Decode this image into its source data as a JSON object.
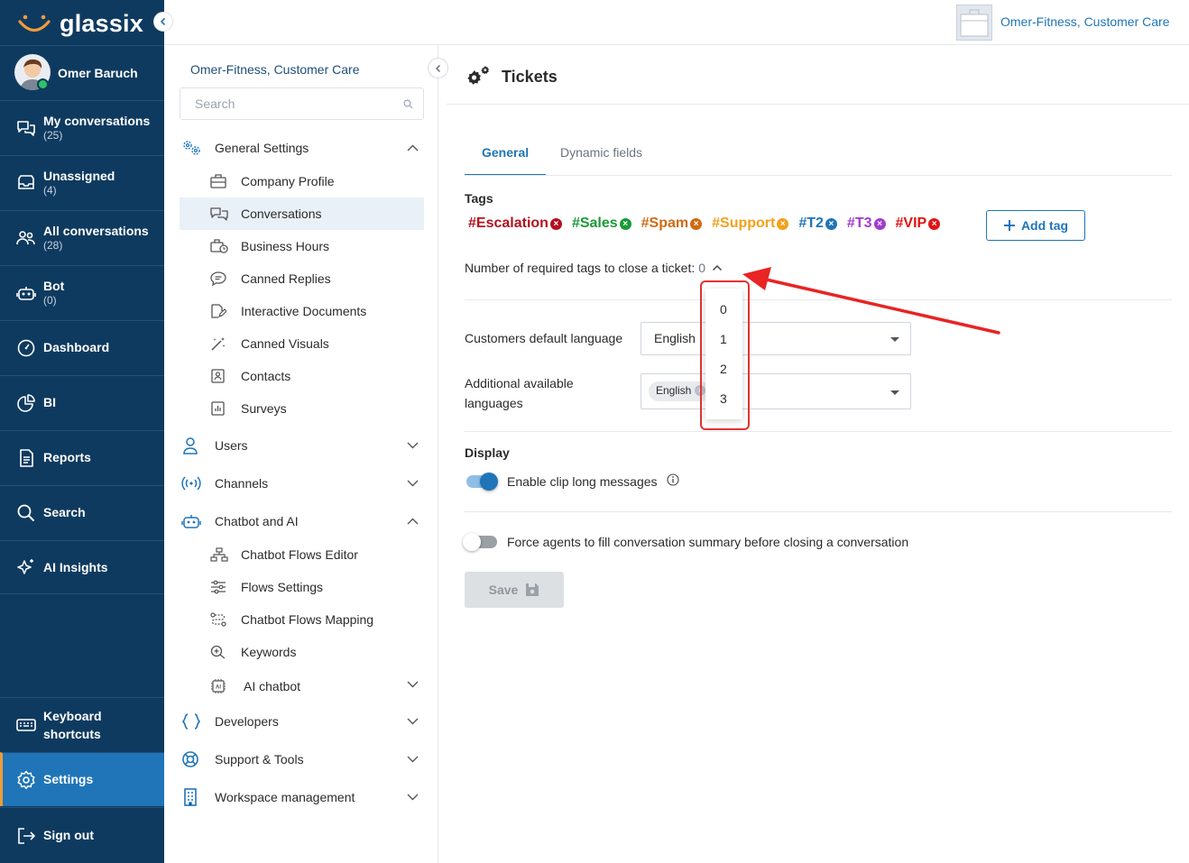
{
  "app": {
    "logo_text": "glassix",
    "workspace": "Omer-Fitness, Customer Care"
  },
  "user": {
    "name": "Omer Baruch"
  },
  "nav": {
    "items": [
      {
        "label": "My conversations",
        "count": "(25)"
      },
      {
        "label": "Unassigned",
        "count": "(4)"
      },
      {
        "label": "All conversations",
        "count": "(28)"
      },
      {
        "label": "Bot",
        "count": "(0)"
      },
      {
        "label": "Dashboard"
      },
      {
        "label": "BI"
      },
      {
        "label": "Reports"
      },
      {
        "label": "Search"
      },
      {
        "label": "AI Insights"
      }
    ],
    "keyboard": "Keyboard shortcuts",
    "settings": "Settings",
    "signout": "Sign out"
  },
  "settings_nav": {
    "title": "Omer-Fitness, Customer Care",
    "search_placeholder": "Search",
    "general": "General Settings",
    "general_items": [
      "Company Profile",
      "Conversations",
      "Business Hours",
      "Canned Replies",
      "Interactive Documents",
      "Canned Visuals",
      "Contacts",
      "Surveys"
    ],
    "users": "Users",
    "channels": "Channels",
    "chatbot": "Chatbot and AI",
    "chatbot_items": [
      "Chatbot Flows Editor",
      "Flows Settings",
      "Chatbot Flows Mapping",
      "Keywords",
      "AI chatbot"
    ],
    "developers": "Developers",
    "support": "Support & Tools",
    "workspace": "Workspace management"
  },
  "page": {
    "title": "Tickets",
    "tabs": [
      "General",
      "Dynamic fields"
    ],
    "tags_label": "Tags",
    "tags": [
      {
        "label": "#Escalation",
        "color": "#b3121f"
      },
      {
        "label": "#Sales",
        "color": "#1a9a37"
      },
      {
        "label": "#Spam",
        "color": "#d06a12"
      },
      {
        "label": "#Support",
        "color": "#f2a11b"
      },
      {
        "label": "#T2",
        "color": "#1f75b8"
      },
      {
        "label": "#T3",
        "color": "#a03ccf"
      },
      {
        "label": "#VIP",
        "color": "#e31414"
      }
    ],
    "add_tag": "Add tag",
    "required_tags_label": "Number of required tags to close a ticket:",
    "required_tags_value": "0",
    "dropdown_options": [
      "0",
      "1",
      "2",
      "3"
    ],
    "default_language_label": "Customers default language",
    "default_language": "English",
    "additional_languages_label": "Additional available languages",
    "additional_language_chip": "English",
    "display_label": "Display",
    "clip_label": "Enable clip long messages",
    "clip_enabled": true,
    "force_summary_label": "Force agents to fill conversation summary before closing a conversation",
    "force_summary_enabled": false,
    "save": "Save"
  }
}
